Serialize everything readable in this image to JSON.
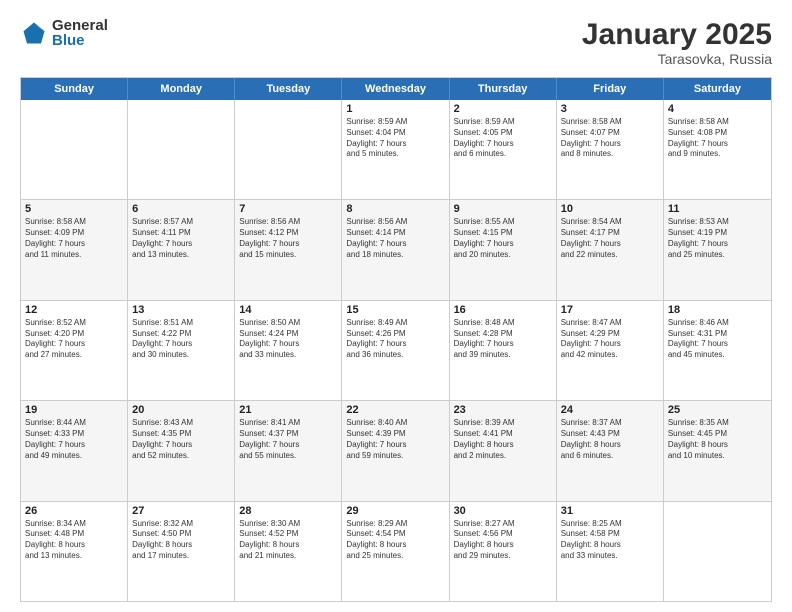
{
  "logo": {
    "general": "General",
    "blue": "Blue"
  },
  "header": {
    "title": "January 2025",
    "subtitle": "Tarasovka, Russia"
  },
  "weekdays": [
    "Sunday",
    "Monday",
    "Tuesday",
    "Wednesday",
    "Thursday",
    "Friday",
    "Saturday"
  ],
  "rows": [
    [
      {
        "day": "",
        "info": ""
      },
      {
        "day": "",
        "info": ""
      },
      {
        "day": "",
        "info": ""
      },
      {
        "day": "1",
        "info": "Sunrise: 8:59 AM\nSunset: 4:04 PM\nDaylight: 7 hours\nand 5 minutes."
      },
      {
        "day": "2",
        "info": "Sunrise: 8:59 AM\nSunset: 4:05 PM\nDaylight: 7 hours\nand 6 minutes."
      },
      {
        "day": "3",
        "info": "Sunrise: 8:58 AM\nSunset: 4:07 PM\nDaylight: 7 hours\nand 8 minutes."
      },
      {
        "day": "4",
        "info": "Sunrise: 8:58 AM\nSunset: 4:08 PM\nDaylight: 7 hours\nand 9 minutes."
      }
    ],
    [
      {
        "day": "5",
        "info": "Sunrise: 8:58 AM\nSunset: 4:09 PM\nDaylight: 7 hours\nand 11 minutes."
      },
      {
        "day": "6",
        "info": "Sunrise: 8:57 AM\nSunset: 4:11 PM\nDaylight: 7 hours\nand 13 minutes."
      },
      {
        "day": "7",
        "info": "Sunrise: 8:56 AM\nSunset: 4:12 PM\nDaylight: 7 hours\nand 15 minutes."
      },
      {
        "day": "8",
        "info": "Sunrise: 8:56 AM\nSunset: 4:14 PM\nDaylight: 7 hours\nand 18 minutes."
      },
      {
        "day": "9",
        "info": "Sunrise: 8:55 AM\nSunset: 4:15 PM\nDaylight: 7 hours\nand 20 minutes."
      },
      {
        "day": "10",
        "info": "Sunrise: 8:54 AM\nSunset: 4:17 PM\nDaylight: 7 hours\nand 22 minutes."
      },
      {
        "day": "11",
        "info": "Sunrise: 8:53 AM\nSunset: 4:19 PM\nDaylight: 7 hours\nand 25 minutes."
      }
    ],
    [
      {
        "day": "12",
        "info": "Sunrise: 8:52 AM\nSunset: 4:20 PM\nDaylight: 7 hours\nand 27 minutes."
      },
      {
        "day": "13",
        "info": "Sunrise: 8:51 AM\nSunset: 4:22 PM\nDaylight: 7 hours\nand 30 minutes."
      },
      {
        "day": "14",
        "info": "Sunrise: 8:50 AM\nSunset: 4:24 PM\nDaylight: 7 hours\nand 33 minutes."
      },
      {
        "day": "15",
        "info": "Sunrise: 8:49 AM\nSunset: 4:26 PM\nDaylight: 7 hours\nand 36 minutes."
      },
      {
        "day": "16",
        "info": "Sunrise: 8:48 AM\nSunset: 4:28 PM\nDaylight: 7 hours\nand 39 minutes."
      },
      {
        "day": "17",
        "info": "Sunrise: 8:47 AM\nSunset: 4:29 PM\nDaylight: 7 hours\nand 42 minutes."
      },
      {
        "day": "18",
        "info": "Sunrise: 8:46 AM\nSunset: 4:31 PM\nDaylight: 7 hours\nand 45 minutes."
      }
    ],
    [
      {
        "day": "19",
        "info": "Sunrise: 8:44 AM\nSunset: 4:33 PM\nDaylight: 7 hours\nand 49 minutes."
      },
      {
        "day": "20",
        "info": "Sunrise: 8:43 AM\nSunset: 4:35 PM\nDaylight: 7 hours\nand 52 minutes."
      },
      {
        "day": "21",
        "info": "Sunrise: 8:41 AM\nSunset: 4:37 PM\nDaylight: 7 hours\nand 55 minutes."
      },
      {
        "day": "22",
        "info": "Sunrise: 8:40 AM\nSunset: 4:39 PM\nDaylight: 7 hours\nand 59 minutes."
      },
      {
        "day": "23",
        "info": "Sunrise: 8:39 AM\nSunset: 4:41 PM\nDaylight: 8 hours\nand 2 minutes."
      },
      {
        "day": "24",
        "info": "Sunrise: 8:37 AM\nSunset: 4:43 PM\nDaylight: 8 hours\nand 6 minutes."
      },
      {
        "day": "25",
        "info": "Sunrise: 8:35 AM\nSunset: 4:45 PM\nDaylight: 8 hours\nand 10 minutes."
      }
    ],
    [
      {
        "day": "26",
        "info": "Sunrise: 8:34 AM\nSunset: 4:48 PM\nDaylight: 8 hours\nand 13 minutes."
      },
      {
        "day": "27",
        "info": "Sunrise: 8:32 AM\nSunset: 4:50 PM\nDaylight: 8 hours\nand 17 minutes."
      },
      {
        "day": "28",
        "info": "Sunrise: 8:30 AM\nSunset: 4:52 PM\nDaylight: 8 hours\nand 21 minutes."
      },
      {
        "day": "29",
        "info": "Sunrise: 8:29 AM\nSunset: 4:54 PM\nDaylight: 8 hours\nand 25 minutes."
      },
      {
        "day": "30",
        "info": "Sunrise: 8:27 AM\nSunset: 4:56 PM\nDaylight: 8 hours\nand 29 minutes."
      },
      {
        "day": "31",
        "info": "Sunrise: 8:25 AM\nSunset: 4:58 PM\nDaylight: 8 hours\nand 33 minutes."
      },
      {
        "day": "",
        "info": ""
      }
    ]
  ]
}
